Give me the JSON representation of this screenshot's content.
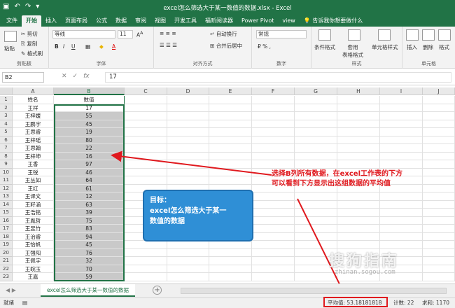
{
  "window": {
    "title": "excel怎么筛选大于某一数值的数据.xlsx  -  Excel"
  },
  "tabs": [
    "文件",
    "开始",
    "插入",
    "页面布局",
    "公式",
    "数据",
    "审阅",
    "视图",
    "开发工具",
    "福昕阅读器",
    "Power Pivot",
    "view"
  ],
  "tell_me": "告诉我你想要做什么",
  "ribbon": {
    "clipboard": {
      "label": "剪贴板",
      "paste": "粘贴",
      "cut": "剪切",
      "copy": "复制",
      "format_painter": "格式刷"
    },
    "font": {
      "label": "字体",
      "name": "等线",
      "size": "11"
    },
    "alignment": {
      "label": "对齐方式",
      "wrap": "自动换行",
      "merge": "合并后居中"
    },
    "number": {
      "label": "数字",
      "format": "常规"
    },
    "styles": {
      "label": "样式",
      "conditional": "条件格式",
      "table": "套用\n表格格式",
      "cell_styles": "单元格样式"
    },
    "cells": {
      "label": "单元格",
      "insert": "插入",
      "delete": "删除",
      "format": "格式"
    }
  },
  "formula": {
    "name_box": "B2",
    "content": "17"
  },
  "columns": [
    "A",
    "B",
    "C",
    "D",
    "E",
    "F",
    "G",
    "H",
    "I",
    "J"
  ],
  "rows": [
    {
      "n": "1",
      "a": "姓名",
      "b": "数值"
    },
    {
      "n": "2",
      "a": "王祥",
      "b": "17"
    },
    {
      "n": "3",
      "a": "王梓媛",
      "b": "55"
    },
    {
      "n": "4",
      "a": "王鹏宇",
      "b": "45"
    },
    {
      "n": "5",
      "a": "王思睿",
      "b": "19"
    },
    {
      "n": "6",
      "a": "王梓瑶",
      "b": "80"
    },
    {
      "n": "7",
      "a": "王思翰",
      "b": "22"
    },
    {
      "n": "8",
      "a": "王梓坤",
      "b": "16"
    },
    {
      "n": "9",
      "a": "王香",
      "b": "97"
    },
    {
      "n": "10",
      "a": "王锐",
      "b": "46"
    },
    {
      "n": "11",
      "a": "王丛如",
      "b": "64"
    },
    {
      "n": "12",
      "a": "王红",
      "b": "61"
    },
    {
      "n": "13",
      "a": "王译文",
      "b": "12"
    },
    {
      "n": "14",
      "a": "王籽涵",
      "b": "63"
    },
    {
      "n": "15",
      "a": "王浩铭",
      "b": "39"
    },
    {
      "n": "16",
      "a": "王胤哲",
      "b": "75"
    },
    {
      "n": "17",
      "a": "王昱竹",
      "b": "83"
    },
    {
      "n": "18",
      "a": "王治睿",
      "b": "94"
    },
    {
      "n": "19",
      "a": "王怡帆",
      "b": "45"
    },
    {
      "n": "20",
      "a": "王强阳",
      "b": "76"
    },
    {
      "n": "21",
      "a": "王佩宇",
      "b": "32"
    },
    {
      "n": "22",
      "a": "王皖玉",
      "b": "70"
    },
    {
      "n": "23",
      "a": "王嘉",
      "b": "59"
    }
  ],
  "callout": {
    "line1": "目标：",
    "line2": "excel怎么筛选大于某一",
    "line3": "数值的数据"
  },
  "annotation": {
    "line1": "选择B列所有数据，在excel工作表的下方",
    "line2": "可以看到下方显示出这组数据的平均值"
  },
  "sheet_tab": "excel怎么筛选大于某一数值的数据",
  "status": {
    "ready": "就绪",
    "average": "平均值: 53.18181818",
    "count": "计数: 22",
    "sum": "求和: 1170"
  },
  "watermark": {
    "text": "搜狗指南",
    "url": "zhinan.sogou.com"
  },
  "colors": {
    "accent": "#217346",
    "highlight": "#e0191e",
    "callout": "#2f8fd6"
  }
}
